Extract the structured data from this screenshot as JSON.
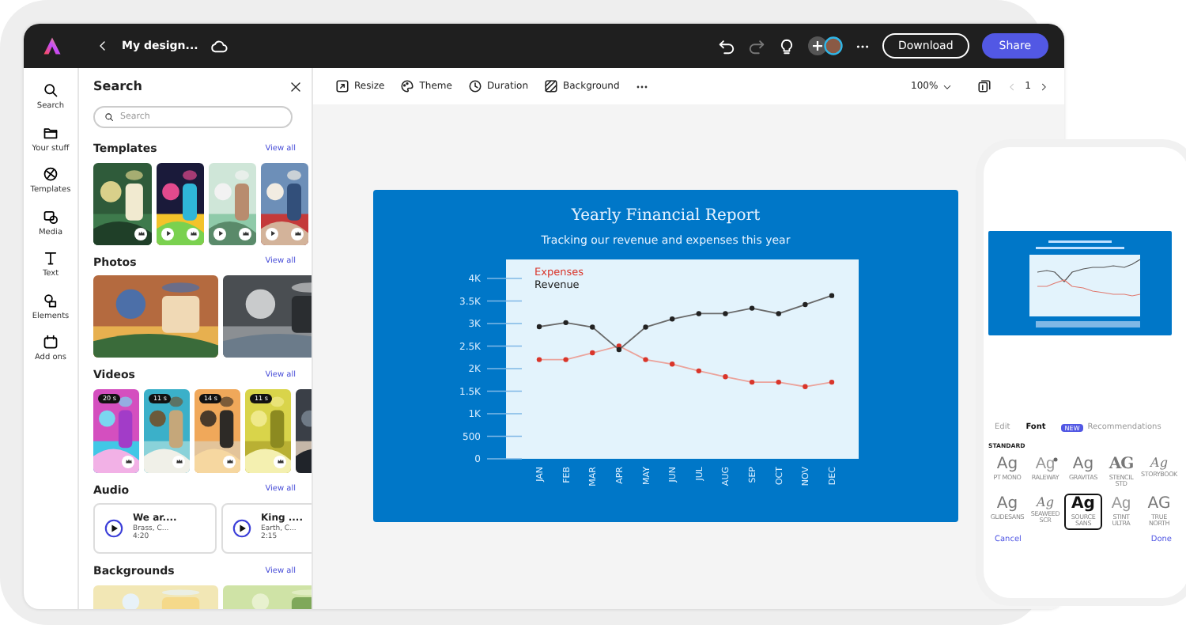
{
  "app": {
    "title": "My design..."
  },
  "topbar": {
    "download": "Download",
    "share": "Share"
  },
  "rail": [
    {
      "label": "Search",
      "kind": "search"
    },
    {
      "label": "Your stuff",
      "kind": "folder"
    },
    {
      "label": "Templates",
      "kind": "templates"
    },
    {
      "label": "Media",
      "kind": "media"
    },
    {
      "label": "Text",
      "kind": "text"
    },
    {
      "label": "Elements",
      "kind": "elements"
    },
    {
      "label": "Add ons",
      "kind": "addons"
    }
  ],
  "panel": {
    "title": "Search",
    "search": {
      "placeholder": "Search"
    },
    "sections": [
      {
        "title": "Templates",
        "link": "View all",
        "kind": "templates",
        "items": [
          {
            "kind": "picture",
            "video": false
          },
          {
            "kind": "picture",
            "video": true
          },
          {
            "kind": "picture",
            "video": true
          },
          {
            "kind": "picture",
            "video": true
          }
        ]
      },
      {
        "title": "Photos",
        "link": "View all",
        "kind": "photos",
        "items": [
          {
            "kind": "picture"
          },
          {
            "kind": "picture"
          }
        ]
      },
      {
        "title": "Videos",
        "link": "View all",
        "kind": "videos",
        "items": [
          {
            "kind": "picture",
            "duration": "20 s"
          },
          {
            "kind": "picture",
            "duration": "11 s"
          },
          {
            "kind": "picture",
            "duration": "14 s"
          },
          {
            "kind": "picture",
            "duration": "11 s"
          },
          {
            "kind": "picture"
          }
        ]
      },
      {
        "title": "Audio",
        "link": "View all",
        "kind": "audio",
        "items": [
          {
            "title": "We ar....",
            "artist": "Brass, C...",
            "time": "4:20"
          },
          {
            "title": "King ....",
            "artist": "Earth, C...",
            "time": "2:15"
          }
        ]
      },
      {
        "title": "Backgrounds",
        "link": "View all",
        "kind": "backgrounds",
        "items": [
          {
            "kind": "picture"
          },
          {
            "kind": "picture"
          }
        ]
      }
    ]
  },
  "toolbar": {
    "tools": [
      {
        "label": "Resize",
        "kind": "resize"
      },
      {
        "label": "Theme",
        "kind": "theme"
      },
      {
        "label": "Duration",
        "kind": "duration"
      },
      {
        "label": "Background",
        "kind": "background"
      }
    ],
    "zoom": "100%",
    "page": "1"
  },
  "design": {
    "title": "Yearly Financial Report",
    "subtitle": "Tracking our revenue and expenses this year",
    "chart_data": {
      "type": "line",
      "categories": [
        "JAN",
        "FEB",
        "MAR",
        "APR",
        "MAY",
        "JUN",
        "JUL",
        "AUG",
        "SEP",
        "OCT",
        "NOV",
        "DEC"
      ],
      "series": [
        {
          "name": "Expenses",
          "color": "#d9352a",
          "marker": "circle",
          "values": [
            2200,
            2200,
            2350,
            2500,
            2200,
            2100,
            1950,
            1820,
            1700,
            1700,
            1600,
            1700
          ]
        },
        {
          "name": "Revenue",
          "color": "#222222",
          "marker": "circle",
          "values": [
            2930,
            3020,
            2920,
            2420,
            2920,
            3100,
            3220,
            3220,
            3340,
            3220,
            3420,
            3620
          ]
        }
      ],
      "ylim": [
        0,
        4000
      ],
      "yticks": [
        {
          "value": 0,
          "label": "0"
        },
        {
          "value": 500,
          "label": "500"
        },
        {
          "value": 1000,
          "label": "1K"
        },
        {
          "value": 1500,
          "label": "1.5K"
        },
        {
          "value": 2000,
          "label": "2K"
        },
        {
          "value": 2500,
          "label": "2.5K"
        },
        {
          "value": 3000,
          "label": "3K"
        },
        {
          "value": 3500,
          "label": "3.5K"
        },
        {
          "value": 4000,
          "label": "4K"
        }
      ]
    }
  },
  "phone": {
    "tabs": [
      {
        "label": "Edit",
        "selected": false
      },
      {
        "label": "Font",
        "selected": true
      },
      {
        "label": "Recommendations",
        "selected": false,
        "badge": "NEW"
      }
    ],
    "section": "STANDARD",
    "fonts": [
      {
        "sample": "Ag",
        "name": "PT MONO",
        "kind": "sans",
        "selected": false,
        "flag": false
      },
      {
        "sample": "Ag",
        "name": "RALEWAY",
        "kind": "light",
        "selected": false,
        "flag": true
      },
      {
        "sample": "Ag",
        "name": "GRAVITAS",
        "kind": "sans",
        "selected": false,
        "flag": false
      },
      {
        "sample": "AG",
        "name": "STENCIL STD",
        "kind": "stencil",
        "selected": false,
        "flag": false
      },
      {
        "sample": "Ag",
        "name": "STORYBOOK",
        "kind": "script",
        "selected": false,
        "flag": false
      },
      {
        "sample": "Ag",
        "name": "GLIDESANS",
        "kind": "sans",
        "selected": false,
        "flag": false
      },
      {
        "sample": "Ag",
        "name": "SEAWEED SCR",
        "kind": "script",
        "selected": false,
        "flag": false
      },
      {
        "sample": "Ag",
        "name": "SOURCE SANS",
        "kind": "bold",
        "selected": true,
        "flag": false
      },
      {
        "sample": "Ag",
        "name": "STINT ULTRA",
        "kind": "light",
        "selected": false,
        "flag": false
      },
      {
        "sample": "AG",
        "name": "TRUE NORTH",
        "kind": "sans",
        "selected": false,
        "flag": false
      }
    ],
    "cancel": "Cancel",
    "done": "Done"
  }
}
